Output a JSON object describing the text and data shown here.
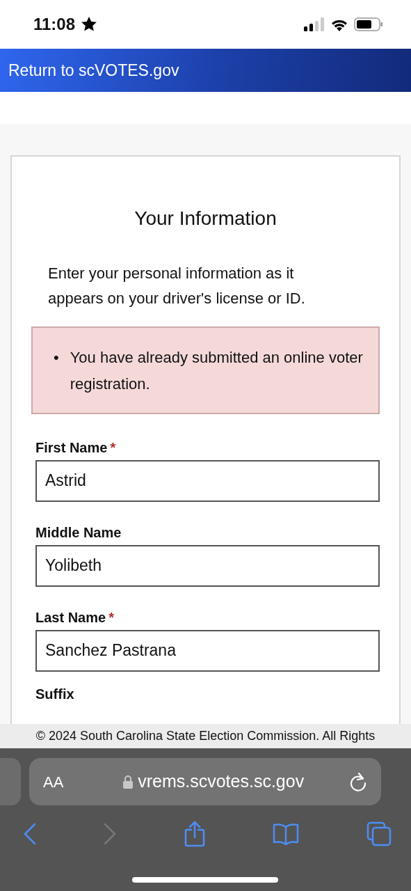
{
  "status_bar": {
    "time": "11:08"
  },
  "top_link": "Return to scVOTES.gov",
  "form": {
    "title": "Your Information",
    "intro": "Enter your personal information as it appears on your driver's license or ID.",
    "errors": [
      {
        "marker": "•",
        "text": "You have already submitted an online voter registration."
      }
    ],
    "fields": [
      {
        "label": "First Name",
        "required_mark": "*",
        "value": "Astrid"
      },
      {
        "label": "Middle Name",
        "value": "Yolibeth"
      },
      {
        "label": "Last Name",
        "required_mark": "*",
        "value": "Sanchez Pastrana"
      }
    ],
    "next_label": "Suffix"
  },
  "footer": "© 2024 South Carolina State Election Commission. All Rights",
  "browser": {
    "text_size": "AA",
    "url": "vrems.scvotes.sc.gov",
    "back_disabled": false,
    "forward_disabled": true
  }
}
